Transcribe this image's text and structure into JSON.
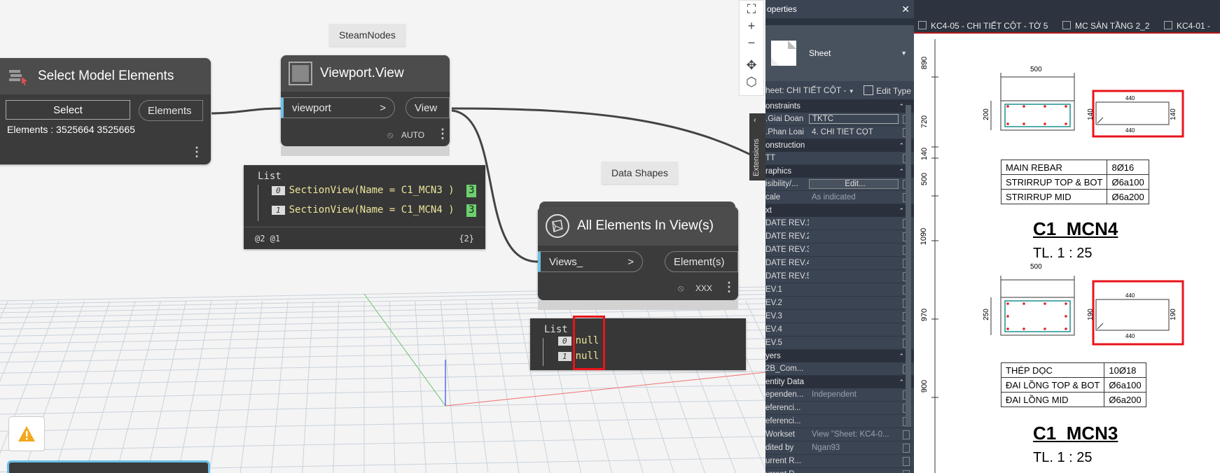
{
  "dynamo": {
    "groups": [
      "SteamNodes",
      "Data Shapes"
    ],
    "select_node": {
      "title": "Select Model Elements",
      "button_label": "Select",
      "output_label": "Elements",
      "info": "Elements : 3525664 3525665"
    },
    "viewport_node": {
      "title": "Viewport.View",
      "input_label": "viewport",
      "input_arrow": ">",
      "output_label": "View",
      "run_state": "AUTO"
    },
    "watch1": {
      "header": "List",
      "items": [
        {
          "index": "0",
          "value": "SectionView(Name = C1_MCN3 )",
          "tag": "3"
        },
        {
          "index": "1",
          "value": "SectionView(Name = C1_MCN4 )",
          "tag": "3"
        }
      ],
      "levels": "@2 @1",
      "count": "{2}"
    },
    "all_elements_node": {
      "title": "All Elements In View(s)",
      "input_label": "Views_",
      "input_arrow": ">",
      "output_label": "Element(s)",
      "run_state": "XXX"
    },
    "watch2": {
      "header": "List",
      "items": [
        {
          "index": "0",
          "value": "null"
        },
        {
          "index": "1",
          "value": "null"
        }
      ]
    },
    "zoom_controls": [
      "⛶",
      "+",
      "−",
      "✥",
      "⬡"
    ],
    "extensions_label": "Extensions",
    "accent_color": "#6ac0e7",
    "highlight_color": "#e8141b"
  },
  "properties": {
    "title": "operties",
    "type_name": "Sheet",
    "selector": "heet: CHI TIẾT CỘT -",
    "edit_type": "Edit Type",
    "sections": [
      {
        "name": "onstraints",
        "rows": [
          {
            "k": ".Giai Doan",
            "v": "TKTC"
          },
          {
            "k": ".Phan Loai",
            "v": "4. CHI TIẾT CỘT"
          }
        ]
      },
      {
        "name": "onstruction",
        "rows": [
          {
            "k": "TT",
            "v": ""
          }
        ]
      },
      {
        "name": "raphics",
        "rows": [
          {
            "k": "isibility/...",
            "v": "Edit..."
          },
          {
            "k": "cale",
            "v": "As indicated"
          }
        ]
      },
      {
        "name": "xt",
        "rows": [
          {
            "k": "DATE REV.1",
            "v": ""
          },
          {
            "k": "DATE REV.2",
            "v": ""
          },
          {
            "k": "DATE REV.3",
            "v": ""
          },
          {
            "k": "DATE REV.4",
            "v": ""
          },
          {
            "k": "DATE REV.5",
            "v": ""
          },
          {
            "k": "EV.1",
            "v": ""
          },
          {
            "k": "EV.2",
            "v": ""
          },
          {
            "k": "EV.3",
            "v": ""
          },
          {
            "k": "EV.4",
            "v": ""
          },
          {
            "k": "EV.5",
            "v": ""
          }
        ]
      },
      {
        "name": "yers",
        "rows": [
          {
            "k": "2B_Com...",
            "v": ""
          }
        ]
      },
      {
        "name": "entity Data",
        "rows": [
          {
            "k": "ependen...",
            "v": "Independent"
          },
          {
            "k": "eferenci...",
            "v": ""
          },
          {
            "k": "eferenci...",
            "v": ""
          },
          {
            "k": "Workset",
            "v": "View \"Sheet: KC4-0..."
          },
          {
            "k": "dited by",
            "v": "Ngan93"
          },
          {
            "k": "urrent R...",
            "v": ""
          },
          {
            "k": "urrent R...",
            "v": ""
          }
        ]
      }
    ]
  },
  "drawing": {
    "tabs": [
      "KC4-05 - CHI TIẾT CỘT - TỜ 5",
      "MC SÀN TẦNG 2_2",
      "KC4-01 -"
    ],
    "elevation_labels": [
      "890",
      "720",
      "140",
      "500",
      "1090",
      "970",
      "900"
    ],
    "section_top": {
      "width_dim": "500",
      "height_dim": "200",
      "stirrup_dims": [
        "140",
        "140"
      ],
      "stirrup_len": "440",
      "table": [
        [
          "MAIN REBAR",
          "8Ø16"
        ],
        [
          "STRIRRUP TOP & BOT",
          "Ø6a100"
        ],
        [
          "STRIRRUP MID",
          "Ø6a200"
        ]
      ],
      "title": "C1_MCN4",
      "scale": "TL. 1 : 25"
    },
    "section_bottom": {
      "width_dim": "500",
      "height_dim": "250",
      "stirrup_dims": [
        "190",
        "190"
      ],
      "stirrup_len": "440",
      "table": [
        [
          "THÉP DỌC",
          "10Ø18"
        ],
        [
          "ĐAI LỒNG TOP & BOT",
          "Ø6a100"
        ],
        [
          "ĐAI LỒNG MID",
          "Ø6a200"
        ]
      ],
      "title": "C1_MCN3",
      "scale": "TL. 1 : 25"
    }
  }
}
